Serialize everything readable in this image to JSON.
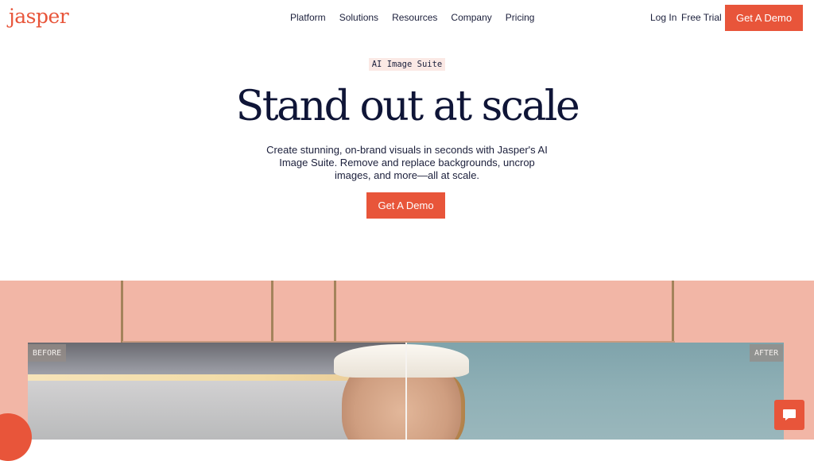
{
  "brand": {
    "logo_text": "jasper",
    "accent_color": "#e8553a"
  },
  "header": {
    "nav": [
      "Platform",
      "Solutions",
      "Resources",
      "Company",
      "Pricing"
    ],
    "login": "Log In",
    "free_trial": "Free Trial",
    "cta": "Get A Demo"
  },
  "hero": {
    "eyebrow": "AI Image Suite",
    "headline": "Stand out at scale",
    "subcopy": "Create stunning, on-brand visuals in seconds with Jasper's AI Image Suite. Remove and replace backgrounds, uncrop images, and more—all at scale.",
    "cta": "Get A Demo"
  },
  "showcase": {
    "before_label": "BEFORE",
    "after_label": "AFTER",
    "background_color": "#f2b6a6"
  },
  "chat": {
    "icon": "chat-bubble-icon"
  }
}
